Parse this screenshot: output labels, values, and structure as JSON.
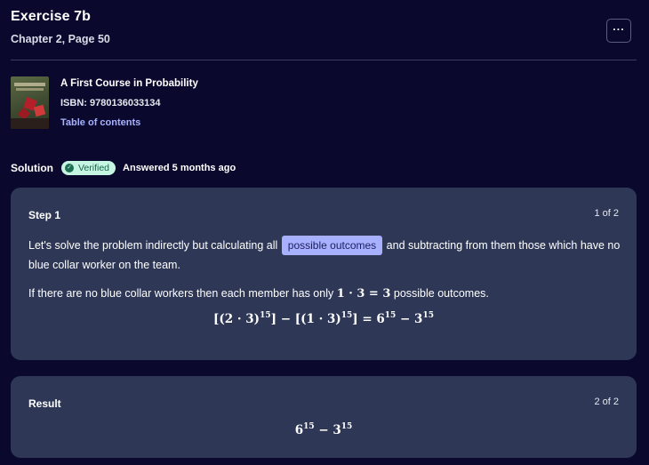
{
  "header": {
    "title": "Exercise 7b",
    "subtitle": "Chapter 2, Page 50",
    "more_label": "···"
  },
  "book": {
    "name": "A First Course in Probability",
    "isbn": "ISBN: 9780136033134",
    "toc_label": "Table of contents"
  },
  "solution": {
    "label": "Solution",
    "badge": "Verified",
    "answered": "Answered 5 months ago"
  },
  "step1": {
    "title": "Step 1",
    "count": "1 of 2",
    "text_before": "Let's solve the problem indirectly but calculating all",
    "highlight": "possible outcomes",
    "text_after": "and subtracting from them those which have no blue collar worker on the team.",
    "line2_before": "If there are no blue collar workers then each member has only",
    "line2_math": "1 · 3 = 3",
    "line2_after": "possible outcomes.",
    "eq_a": "[(2 · 3)",
    "eq_a_exp": "15",
    "eq_b": "] − [(1 · 3)",
    "eq_b_exp": "15",
    "eq_c": "] = 6",
    "eq_c_exp": "15",
    "eq_d": " − 3",
    "eq_d_exp": "15"
  },
  "result": {
    "title": "Result",
    "count": "2 of 2",
    "r_a": "6",
    "r_a_exp": "15",
    "r_b": " − 3",
    "r_b_exp": "15"
  },
  "colors": {
    "background": "#0a092d",
    "card": "#2e3856",
    "accent": "#a8b1ff",
    "verified_bg": "#c6f6e2"
  }
}
